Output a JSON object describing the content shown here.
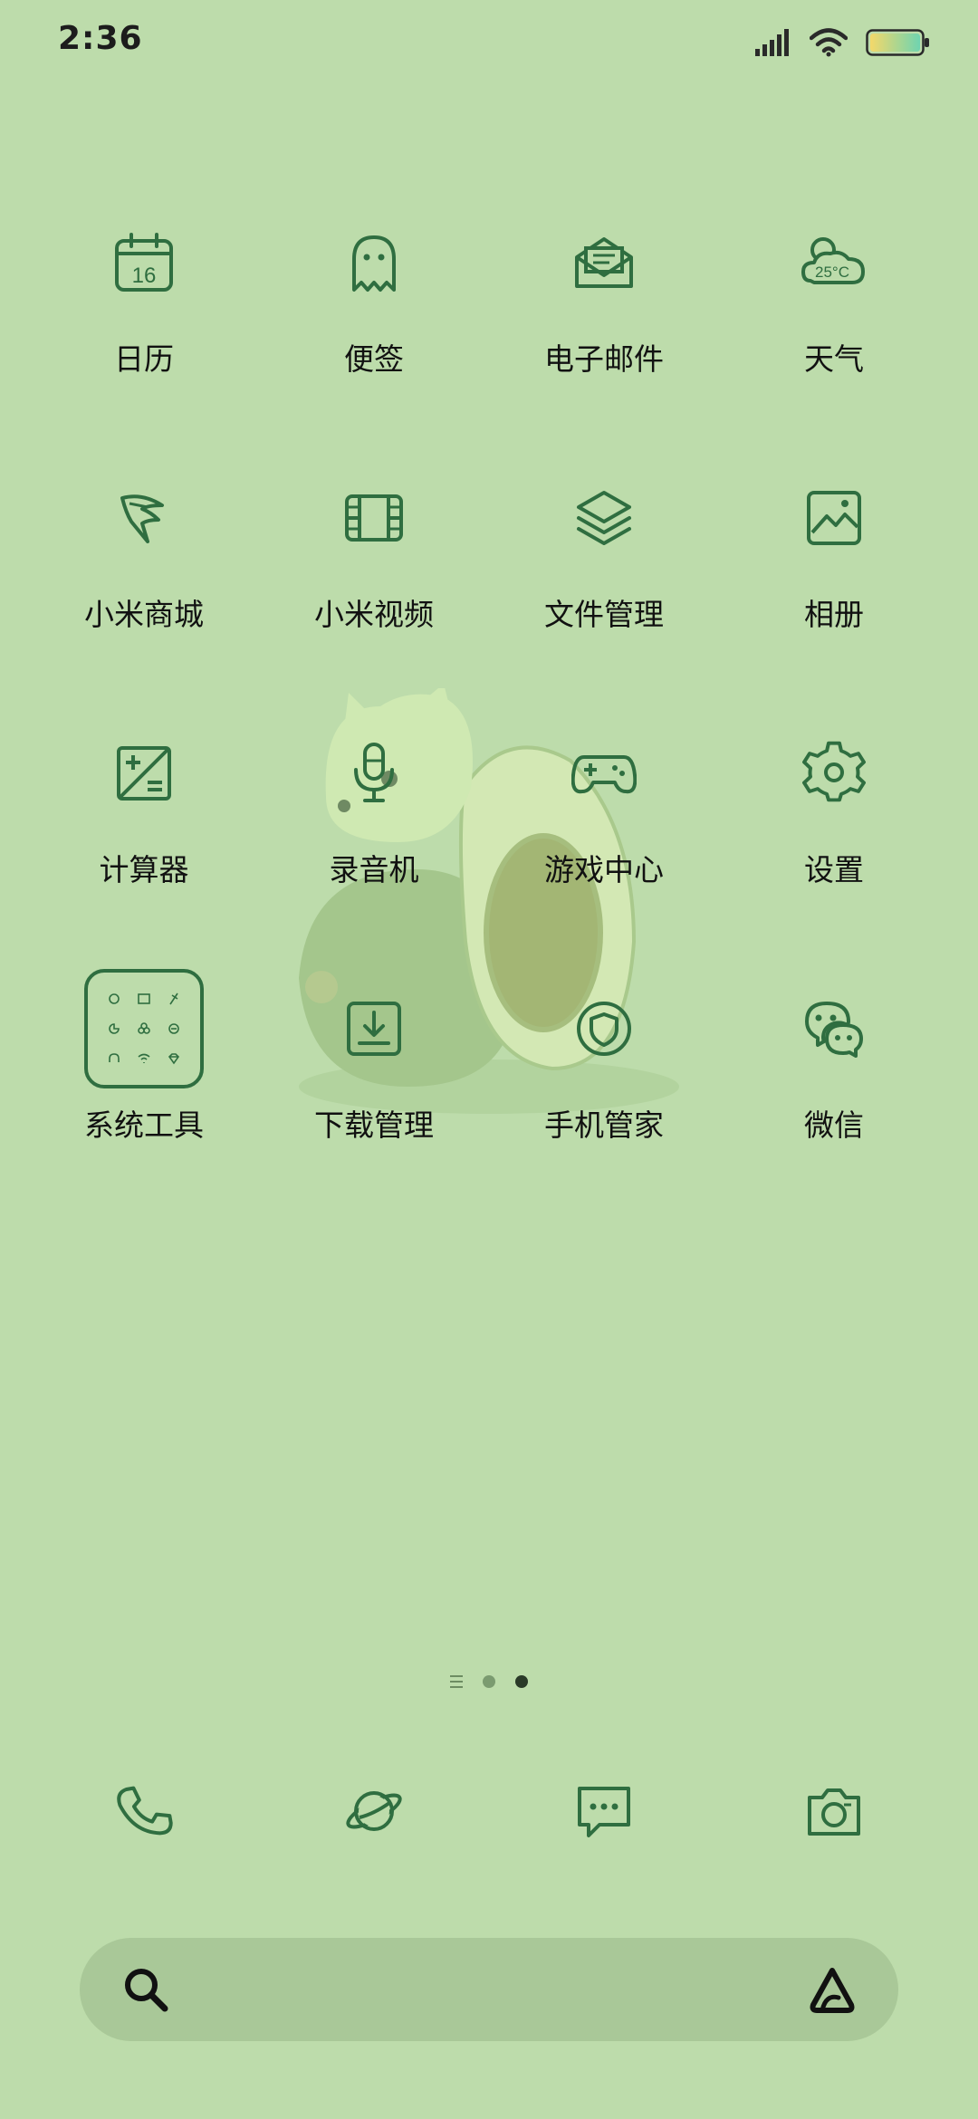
{
  "status_bar": {
    "time": "2:36",
    "icons": [
      "signal-icon",
      "wifi-icon",
      "battery-icon"
    ]
  },
  "apps": [
    {
      "label": "日历",
      "icon": "calendar-icon",
      "icon_text": "16"
    },
    {
      "label": "便签",
      "icon": "notes-ghost-icon"
    },
    {
      "label": "电子邮件",
      "icon": "email-icon"
    },
    {
      "label": "天气",
      "icon": "weather-icon",
      "icon_text": "25°C"
    },
    {
      "label": "小米商城",
      "icon": "mi-store-icon"
    },
    {
      "label": "小米视频",
      "icon": "video-icon"
    },
    {
      "label": "文件管理",
      "icon": "file-manager-icon"
    },
    {
      "label": "相册",
      "icon": "gallery-icon"
    },
    {
      "label": "计算器",
      "icon": "calculator-icon"
    },
    {
      "label": "录音机",
      "icon": "recorder-icon"
    },
    {
      "label": "游戏中心",
      "icon": "game-center-icon"
    },
    {
      "label": "设置",
      "icon": "settings-icon"
    },
    {
      "label": "系统工具",
      "icon": "folder-icon"
    },
    {
      "label": "下载管理",
      "icon": "downloads-icon"
    },
    {
      "label": "手机管家",
      "icon": "security-icon"
    },
    {
      "label": "微信",
      "icon": "wechat-icon"
    }
  ],
  "page_indicator": {
    "pages": 3,
    "current": 2
  },
  "dock": [
    "phone-icon",
    "browser-icon",
    "messages-icon",
    "camera-icon"
  ],
  "search_bar": {
    "left_icon": "search-icon",
    "right_icon": "assistant-icon"
  },
  "colors": {
    "background": "#bddcab",
    "icon_stroke": "#2f6e40",
    "search_bar": "#a9c898"
  }
}
